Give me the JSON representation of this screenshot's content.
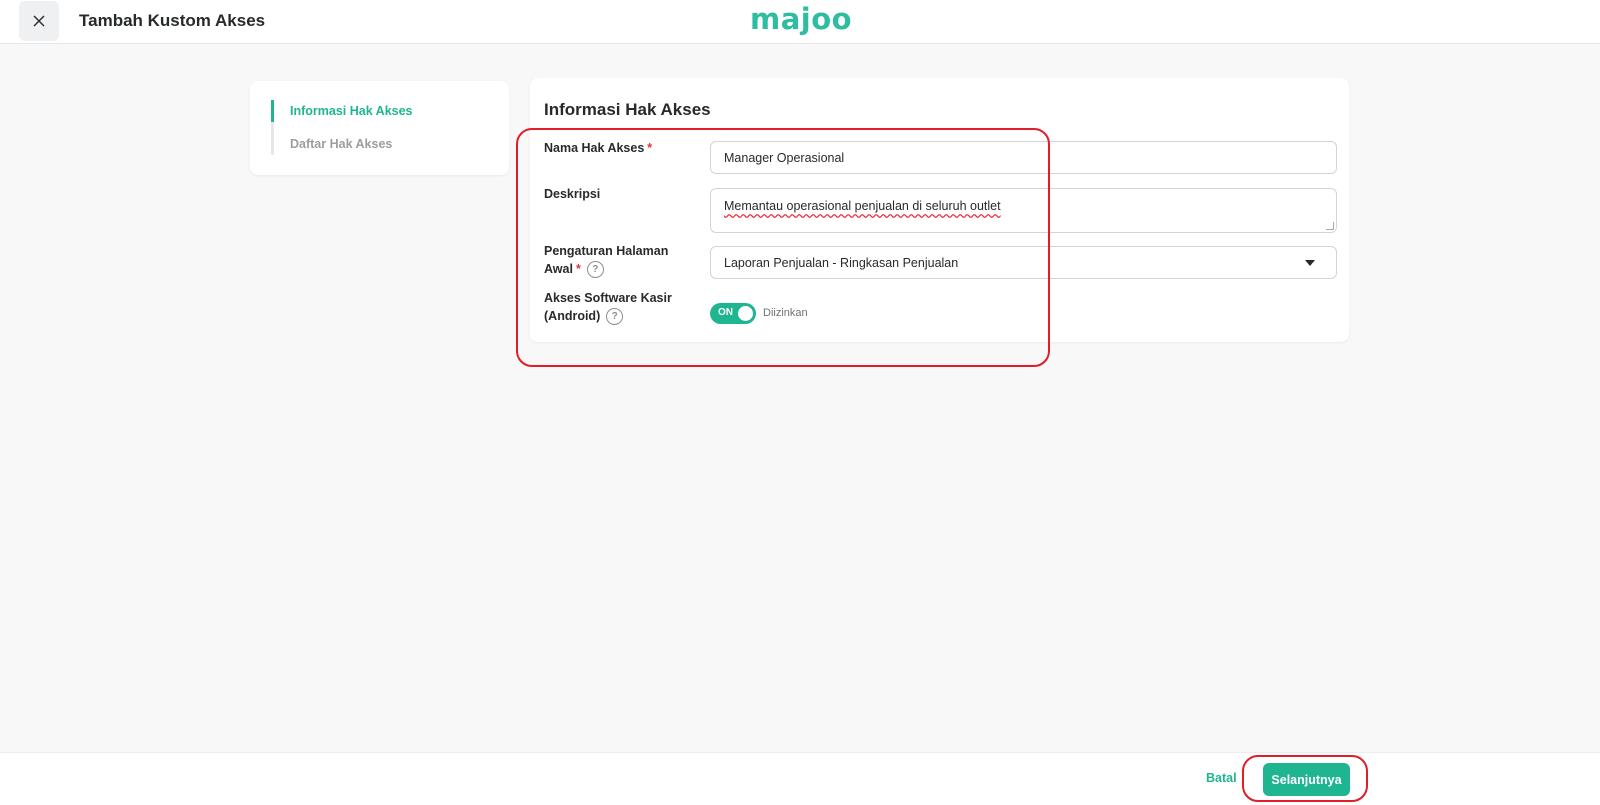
{
  "header": {
    "title": "Tambah Kustom Akses",
    "logo_text": "majoo",
    "close_icon": "close-icon"
  },
  "sidebar": {
    "steps": [
      {
        "label": "Informasi Hak Akses",
        "active": true
      },
      {
        "label": "Daftar Hak Akses",
        "active": false
      }
    ]
  },
  "form": {
    "title": "Informasi Hak Akses",
    "name_label": "Nama Hak Akses",
    "name_value": "Manager Operasional",
    "description_label": "Deskripsi",
    "description_value": "Memantau operasional penjualan di seluruh outlet",
    "homepage_label_line1": "Pengaturan Halaman",
    "homepage_label_line2": "Awal",
    "homepage_value": "Laporan Penjualan - Ringkasan Penjualan",
    "cashier_label_line1": "Akses Software Kasir",
    "cashier_label_line2": "(Android)",
    "toggle_text": "ON",
    "toggle_status": "Diizinkan",
    "required_mark": "*",
    "help_mark": "?"
  },
  "footer": {
    "cancel_label": "Batal",
    "next_label": "Selanjutnya"
  },
  "colors": {
    "accent": "#1fb591",
    "required": "#e5323b",
    "annotation": "#e11d28"
  }
}
